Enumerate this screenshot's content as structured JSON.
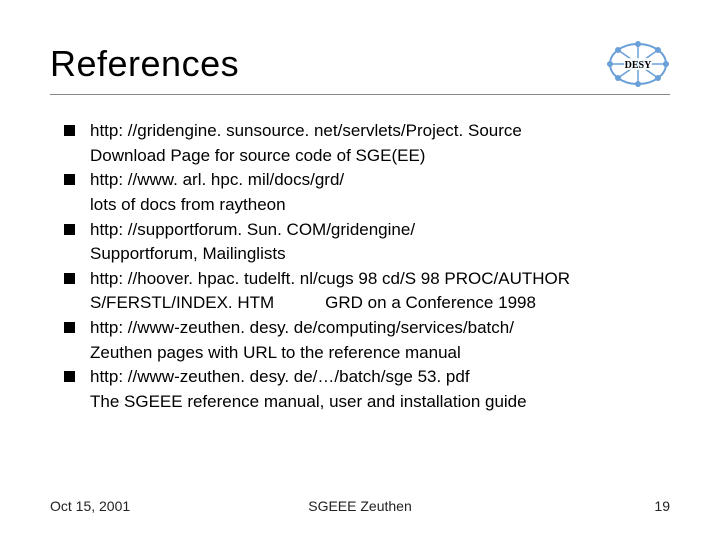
{
  "title": "References",
  "logo_text": "DESY",
  "bullets": [
    {
      "line1": "http: //gridengine. sunsource. net/servlets/Project. Source",
      "line2": "Download Page for source code of SGE(EE)"
    },
    {
      "line1": "http: //www. arl. hpc. mil/docs/grd/",
      "line2": "lots of docs from raytheon"
    },
    {
      "line1": "http: //supportforum. Sun. COM/gridengine/",
      "line2": "Supportforum, Mailinglists"
    },
    {
      "line1": "http: //hoover. hpac. tudelft. nl/cugs 98 cd/S 98 PROC/AUTHOR",
      "line2": "S/FERSTL/INDEX. HTM   GRD on a Conference 1998"
    },
    {
      "line1": "http: //www-zeuthen. desy. de/computing/services/batch/",
      "line2": "Zeuthen pages with URL to the reference manual"
    },
    {
      "line1": "http: //www-zeuthen. desy. de/…/batch/sge 53. pdf",
      "line2": "The SGEEE reference manual, user and installation guide"
    }
  ],
  "footer": {
    "date": "Oct 15, 2001",
    "center": "SGEEE Zeuthen",
    "page": "19"
  }
}
